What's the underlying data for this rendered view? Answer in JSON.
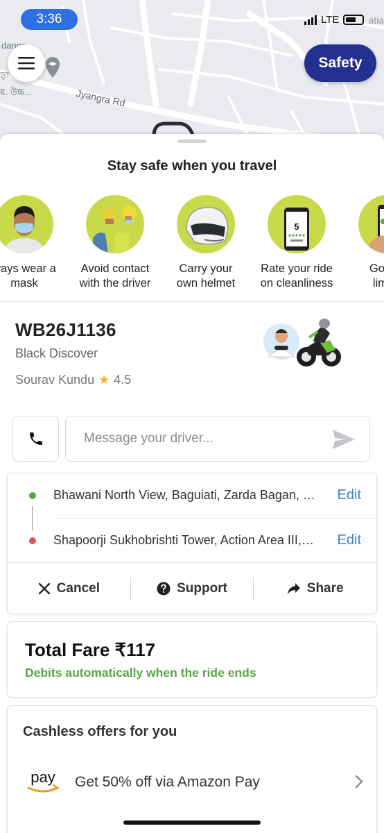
{
  "status_bar": {
    "time": "3:36",
    "network": "LTE",
    "carrier_partial": "atia"
  },
  "map": {
    "road_name": "Jyangra Rd",
    "labels": [
      "danga",
      "ড়া",
      "য়. উচ্চ..."
    ]
  },
  "header": {
    "safety_label": "Safety"
  },
  "safety_sheet": {
    "title": "Stay safe when you travel",
    "tips": [
      {
        "line1": "ways wear a",
        "line2": "mask",
        "icon": "mask-person-icon"
      },
      {
        "line1": "Avoid contact",
        "line2": "with the driver",
        "icon": "riders-icon"
      },
      {
        "line1": "Carry your",
        "line2": "own helmet",
        "icon": "helmet-icon"
      },
      {
        "line1": "Rate your ride",
        "line2": "on cleanliness",
        "icon": "phone-rating-icon"
      },
      {
        "line1": "Go cas",
        "line2": "limit c",
        "icon": "phone-hand-icon"
      }
    ],
    "rating_number": "5"
  },
  "driver": {
    "plate": "WB26J1136",
    "vehicle": "Black Discover",
    "name": "Sourav Kundu",
    "rating": "4.5"
  },
  "contact": {
    "message_placeholder": "Message your driver..."
  },
  "route": {
    "pickup": "Bhawani North View, Baguiati, Zarda Bagan, Rajarhat",
    "drop": "Shapoorji Sukhobrishti Tower, Action Area III, New Town",
    "edit_label": "Edit",
    "pickup_color": "#5aa544",
    "drop_color": "#e0574f"
  },
  "actions": {
    "cancel": "Cancel",
    "support": "Support",
    "share": "Share"
  },
  "fare": {
    "title": "Total Fare ₹117",
    "subtitle": "Debits automatically when the ride ends"
  },
  "offers": {
    "title": "Cashless offers for you",
    "pay_logo_text": "pay",
    "item": "Get 50% off via Amazon Pay"
  },
  "colors": {
    "accent": "#24308f",
    "green": "#5aa544",
    "link": "#3b82c4",
    "tip_bg": "#c8d94a"
  }
}
